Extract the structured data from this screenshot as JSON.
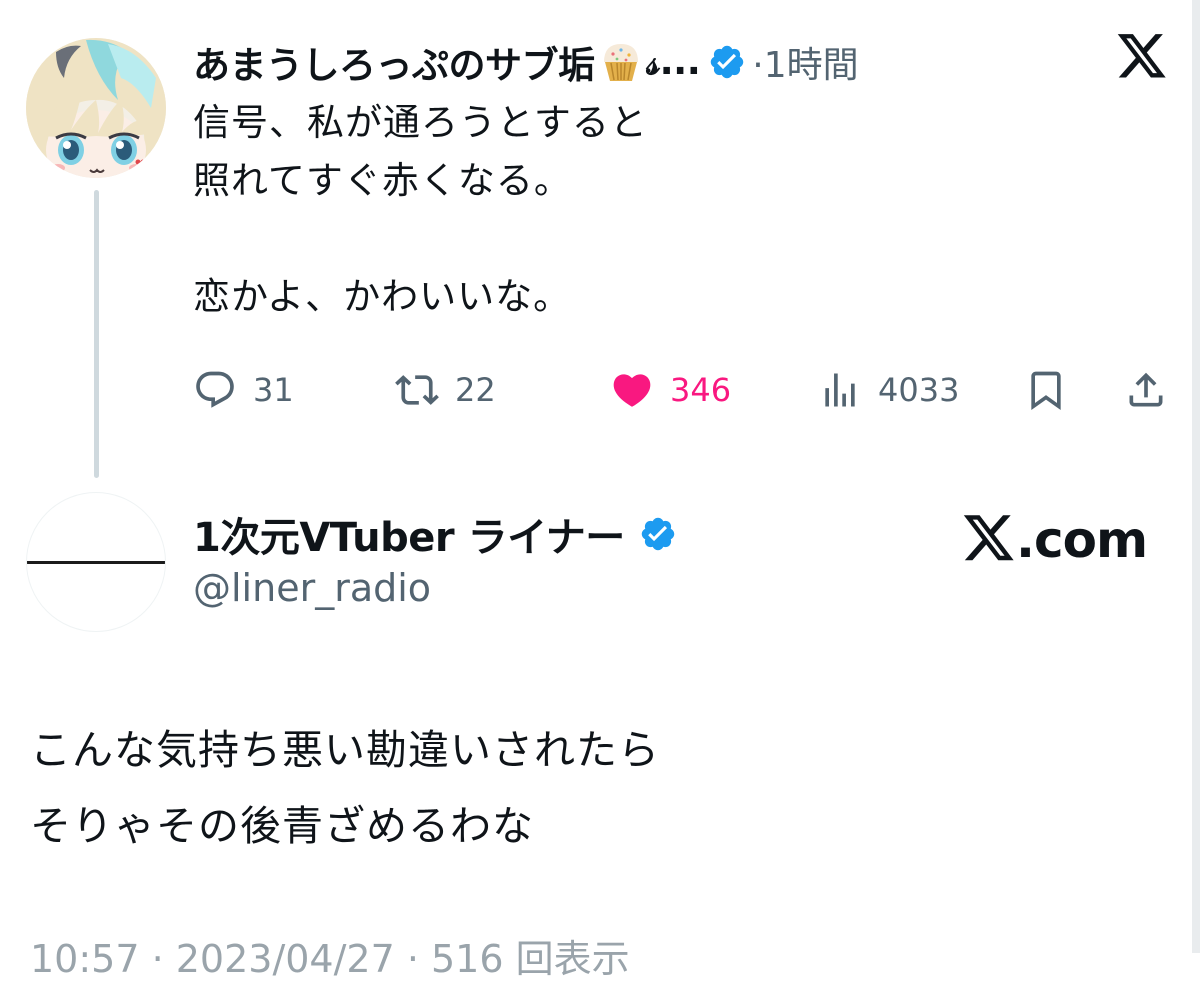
{
  "tweet1": {
    "display_name": "あまうしろっぷのサブ垢",
    "name_suffix": "𝓈...",
    "time": "·1時間",
    "text": "信号、私が通ろうとすると\n照れてすぐ赤くなる。\n\n恋かよ、かわいいな。",
    "actions": {
      "replies": "31",
      "reposts": "22",
      "likes": "346",
      "views": "4033"
    },
    "like_color": "#f91880",
    "verified_color": "#1d9bf0"
  },
  "tweet2": {
    "display_name": "1次元VTuber ライナー",
    "handle": "@liner_radio",
    "brand": ".com",
    "text": "こんな気持ち悪い勘違いされたら\nそりゃその後青ざめるわな",
    "footer": "10:57 · 2023/04/27 · 516 回表示"
  },
  "icons": {
    "platform": "x-logo-icon",
    "verified": "verified-badge-icon",
    "emoji": "cupcake-emoji-icon",
    "reply": "reply-icon",
    "repost": "repost-icon",
    "like": "heart-icon",
    "views": "views-icon",
    "bookmark": "bookmark-icon",
    "share": "share-icon"
  }
}
